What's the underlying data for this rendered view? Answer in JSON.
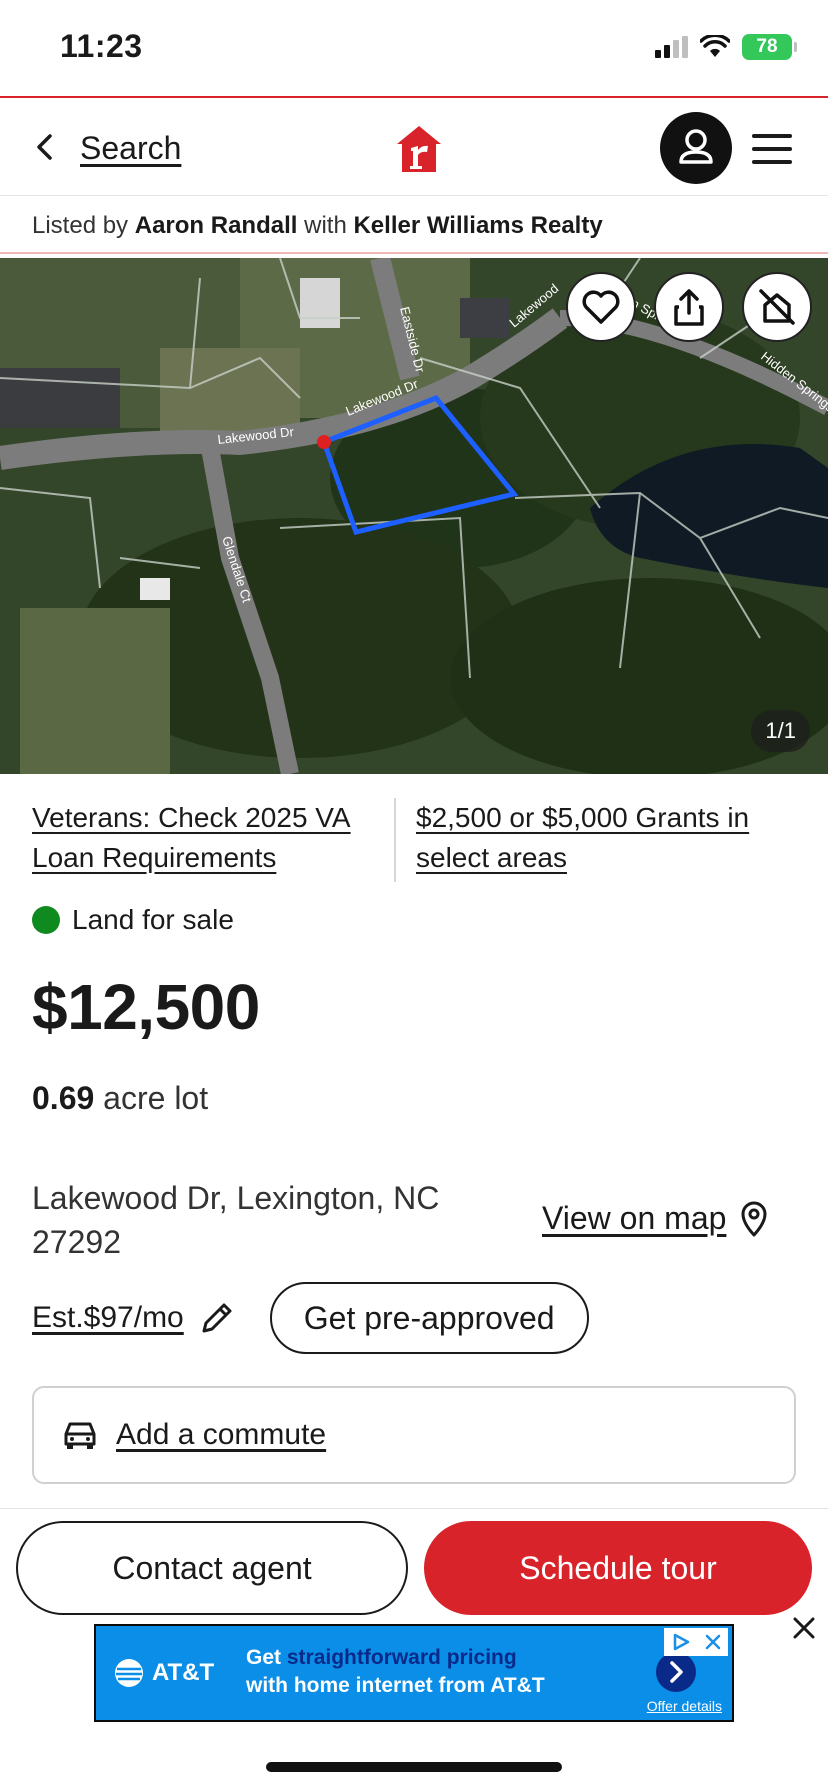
{
  "status_bar": {
    "time": "11:23",
    "battery": "78"
  },
  "nav": {
    "back_label": "Search"
  },
  "listing": {
    "listed_by_prefix": "Listed by",
    "agent_name": "Aaron Randall",
    "with_text": "with",
    "brokerage": "Keller Williams Realty"
  },
  "photo": {
    "counter": "1/1",
    "street_labels": [
      "Lakewood Dr",
      "Lakewood Dr",
      "Lakewood",
      "Eastside Dr",
      "Glendale Ct",
      "Hidden Springs Dr",
      "Hidden Springs"
    ]
  },
  "promos": {
    "left": "Veterans: Check 2025 VA Loan Requirements",
    "right": "$2,500 or $5,000 Grants in select areas"
  },
  "property": {
    "status": "Land for sale",
    "price": "$12,500",
    "lot_size": "0.69",
    "lot_unit": "acre lot",
    "address": "Lakewood Dr, Lexington, NC 27292",
    "view_on_map": "View on map",
    "est_payment": "Est.$97/mo",
    "preapproved": "Get pre-approved",
    "commute": "Add a commute"
  },
  "actions": {
    "contact": "Contact agent",
    "tour": "Schedule tour"
  },
  "ad": {
    "brand": "AT&T",
    "line1_prefix": "Get ",
    "line1_highlight": "straightforward pricing",
    "line2": "with home internet from AT&T",
    "details": "Offer details"
  },
  "colors": {
    "brand_red": "#d8232a",
    "status_green": "#0f8a1f",
    "ad_blue": "#0a8ee8"
  }
}
